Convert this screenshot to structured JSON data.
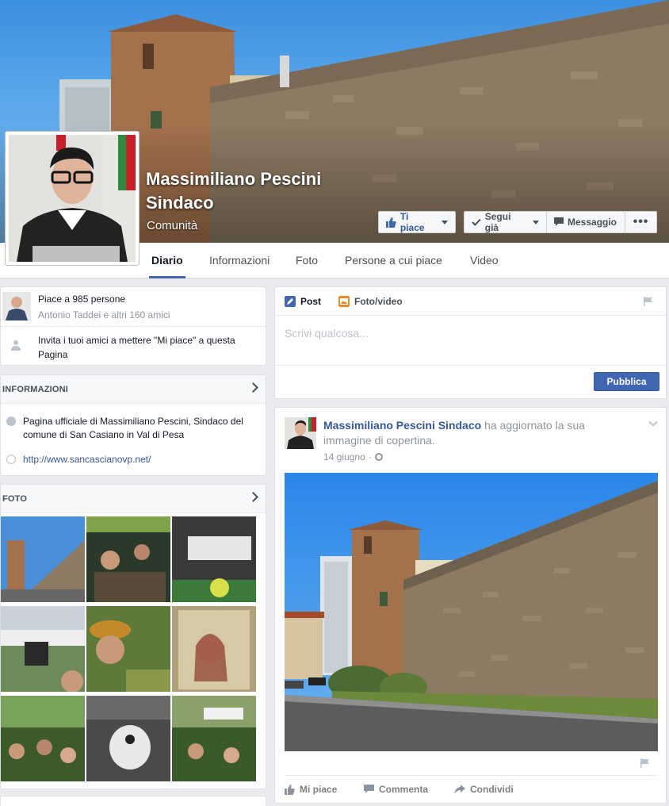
{
  "page": {
    "name": "Massimiliano Pescini Sindaco",
    "category": "Comunità"
  },
  "cover_buttons": {
    "like": "Ti piace",
    "follow": "Segui già",
    "message": "Messaggio",
    "more": "•••"
  },
  "tabs": [
    "Diario",
    "Informazioni",
    "Foto",
    "Persone a cui piace",
    "Video"
  ],
  "likes": {
    "title": "Piace a 985 persone",
    "subtitle": "Antonio Taddei e altri 160 amici",
    "invite": "Invita i tuoi amici a mettere \"Mi piace\" a questa Pagina"
  },
  "info": {
    "heading": "INFORMAZIONI",
    "description": "Pagina ufficiale di Massimiliano Pescini, Sindaco del comune di San Casiano in Val di Pesa",
    "website": "http://www.sancascianovp.net/"
  },
  "photos": {
    "heading": "FOTO"
  },
  "composer": {
    "tab_post": "Post",
    "tab_photo": "Foto/video",
    "placeholder": "Scrivi qualcosa...",
    "publish": "Pubblica"
  },
  "post": {
    "author": "Massimiliano Pescini Sindaco",
    "action_text": "ha aggiornato la sua immagine di copertina.",
    "date": "14 giugno",
    "actions": {
      "like": "Mi piace",
      "comment": "Commenta",
      "share": "Condividi"
    }
  },
  "colors": {
    "brand": "#4267b2",
    "link": "#365899",
    "background": "#e9ebee"
  }
}
